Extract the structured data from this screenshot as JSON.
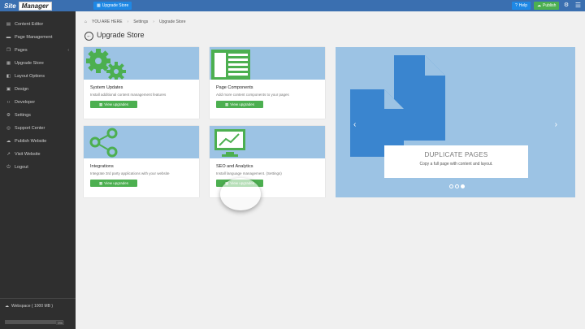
{
  "topbar": {
    "logo_site": "Site",
    "logo_manager": "Manager",
    "store_label": "Upgrade Store",
    "help_label": "Help",
    "publish_label": "Publish"
  },
  "sidebar": {
    "items": [
      {
        "label": "Content Editor",
        "icon": "file-icon"
      },
      {
        "label": "Page Management",
        "icon": "folder-icon"
      },
      {
        "label": "Pages",
        "icon": "copy-icon"
      },
      {
        "label": "Upgrade Store",
        "icon": "store-icon"
      },
      {
        "label": "Layout Options",
        "icon": "layout-icon"
      },
      {
        "label": "Design",
        "icon": "design-icon"
      },
      {
        "label": "Developer",
        "icon": "code-icon"
      },
      {
        "label": "Settings",
        "icon": "gear-icon"
      },
      {
        "label": "Support Center",
        "icon": "support-icon"
      },
      {
        "label": "Publish Website",
        "icon": "upload-icon"
      },
      {
        "label": "Visit Website",
        "icon": "external-icon"
      },
      {
        "label": "Logout",
        "icon": "power-icon"
      }
    ],
    "workspace_label": "Webspace ( 1000 MB )",
    "workspace_pct": "0%",
    "workspace_used_fraction": 0
  },
  "breadcrumb": {
    "prefix": "YOU ARE HERE",
    "crumbs": [
      "Settings",
      "Upgrade Store"
    ]
  },
  "page_title": "Upgrade Store",
  "cards": [
    {
      "title": "System Updates",
      "desc": "Install additional content management features",
      "button": "View upgrades"
    },
    {
      "title": "Page Components",
      "desc": "Add more content components to your pages",
      "button": "View upgrades"
    },
    {
      "title": "Integrations",
      "desc": "Integrate 3rd party applications with your website",
      "button": "View upgrades"
    },
    {
      "title": "SEO and Analytics",
      "desc": "Install language management. (Settings)",
      "button": "View upgrades"
    }
  ],
  "carousel": {
    "title": "DUPLICATE PAGES",
    "subtitle": "Copy a full page with content and layout.",
    "active_index": 2,
    "count": 3
  },
  "colors": {
    "topbar": "#3a6fb0",
    "sidebar": "#2f2f2f",
    "accent_green": "#4caf50",
    "banner": "#9cc3e4",
    "icon_green": "#4caf50",
    "icon_blue": "#3a85cf"
  }
}
